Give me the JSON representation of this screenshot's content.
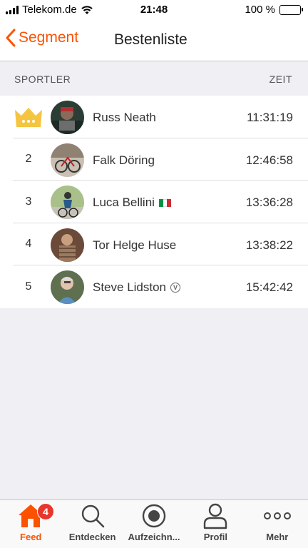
{
  "status_bar": {
    "carrier": "Telekom.de",
    "time": "21:48",
    "battery": "100 %"
  },
  "nav": {
    "back_label": "Segment",
    "title": "Bestenliste"
  },
  "columns": {
    "athlete": "SPORTLER",
    "time": "ZEIT"
  },
  "leaderboard": [
    {
      "rank": "",
      "name": "Russ Neath",
      "time": "11:31:19",
      "crown": true
    },
    {
      "rank": "2",
      "name": "Falk Döring",
      "time": "12:46:58"
    },
    {
      "rank": "3",
      "name": "Luca Bellini",
      "time": "13:36:28",
      "flag": "Italy"
    },
    {
      "rank": "4",
      "name": "Tor Helge Huse",
      "time": "13:38:22"
    },
    {
      "rank": "5",
      "name": "Steve Lidston",
      "time": "15:42:42",
      "verified": true
    }
  ],
  "tabs": [
    {
      "label": "Feed",
      "icon": "home-icon",
      "badge": "4",
      "active": true
    },
    {
      "label": "Entdecken",
      "icon": "search-icon"
    },
    {
      "label": "Aufzeichn...",
      "icon": "record-icon"
    },
    {
      "label": "Profil",
      "icon": "profile-icon"
    },
    {
      "label": "Mehr",
      "icon": "more-icon"
    }
  ],
  "colors": {
    "accent": "#fc5200",
    "crown": "#f5c542",
    "badge": "#e8362b"
  }
}
